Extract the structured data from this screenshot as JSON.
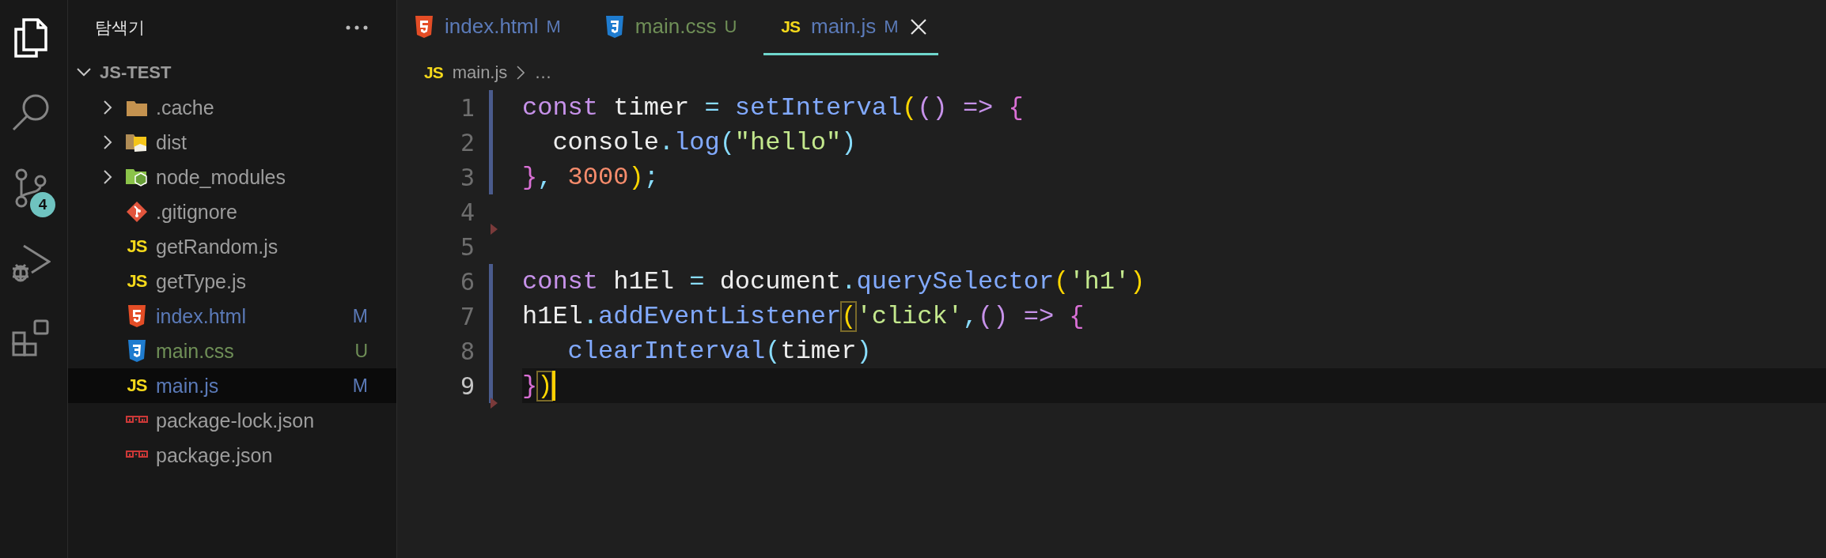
{
  "activity_bar": {
    "items": [
      {
        "kind": "explorer",
        "selected": true
      },
      {
        "kind": "search",
        "selected": false
      },
      {
        "kind": "source-control",
        "selected": false,
        "badge": "4"
      },
      {
        "kind": "run",
        "selected": false
      },
      {
        "kind": "extensions",
        "selected": false
      }
    ]
  },
  "sidebar": {
    "title": "탐색기",
    "root": {
      "label": "JS-TEST",
      "expanded": true,
      "children": [
        {
          "label": ".cache",
          "kind": "folder",
          "expanded": false,
          "selected": false
        },
        {
          "label": "dist",
          "kind": "folder-dist",
          "expanded": false,
          "selected": false
        },
        {
          "label": "node_modules",
          "kind": "folder-node",
          "expanded": false,
          "selected": false
        },
        {
          "label": ".gitignore",
          "kind": "git",
          "selected": false
        },
        {
          "label": "getRandom.js",
          "kind": "js",
          "icon_label": "JS",
          "selected": false
        },
        {
          "label": "getType.js",
          "kind": "js",
          "icon_label": "JS",
          "selected": false
        },
        {
          "label": "index.html",
          "kind": "html",
          "status": "M",
          "color": "#5b7ab8",
          "selected": false
        },
        {
          "label": "main.css",
          "kind": "css",
          "status": "U",
          "color": "#6f8f57",
          "selected": false
        },
        {
          "label": "main.js",
          "kind": "js",
          "icon_label": "JS",
          "status": "M",
          "color": "#5b7ab8",
          "selected": true
        },
        {
          "label": "package-lock.json",
          "kind": "npm",
          "selected": false
        },
        {
          "label": "package.json",
          "kind": "npm",
          "selected": false
        }
      ]
    }
  },
  "tabs": [
    {
      "label": "index.html",
      "kind": "html",
      "status": "M",
      "color": "#5b7ab8",
      "selected": false
    },
    {
      "label": "main.css",
      "kind": "css",
      "status": "U",
      "color": "#6f8f57",
      "selected": false
    },
    {
      "label": "main.js",
      "kind": "js",
      "icon_label": "JS",
      "status": "M",
      "color": "#5b7ab8",
      "selected": true
    }
  ],
  "breadcrumb": {
    "icon_label": "JS",
    "items": [
      "main.js",
      "…"
    ]
  },
  "code": {
    "lines": [
      {
        "number": "1",
        "modified": true,
        "current": false,
        "deleted_after": false,
        "tokens": [
          {
            "text": "const",
            "kind": "keyword"
          },
          {
            "text": " timer ",
            "kind": "ident"
          },
          {
            "text": "=",
            "kind": "op"
          },
          {
            "text": " setInterval",
            "kind": "func"
          },
          {
            "text": "(",
            "kind": "bracket1"
          },
          {
            "text": "()",
            "kind": "bracket2"
          },
          {
            "text": " =>",
            "kind": "keyword"
          },
          {
            "text": " {",
            "kind": "brace"
          }
        ]
      },
      {
        "number": "2",
        "modified": true,
        "current": false,
        "deleted_after": false,
        "tokens": [
          {
            "text": "  console",
            "kind": "ident"
          },
          {
            "text": ".",
            "kind": "punct"
          },
          {
            "text": "log",
            "kind": "func"
          },
          {
            "text": "(",
            "kind": "bracket3"
          },
          {
            "text": "\"hello\"",
            "kind": "string"
          },
          {
            "text": ")",
            "kind": "bracket3"
          }
        ]
      },
      {
        "number": "3",
        "modified": true,
        "current": false,
        "deleted_after": false,
        "tokens": [
          {
            "text": "}",
            "kind": "brace"
          },
          {
            "text": ", ",
            "kind": "punct"
          },
          {
            "text": "3000",
            "kind": "number"
          },
          {
            "text": ")",
            "kind": "bracket1"
          },
          {
            "text": ";",
            "kind": "punct"
          }
        ]
      },
      {
        "number": "4",
        "modified": false,
        "current": false,
        "deleted_after": true
      },
      {
        "number": "5",
        "modified": false,
        "current": false,
        "deleted_after": false
      },
      {
        "number": "6",
        "modified": true,
        "current": false,
        "deleted_after": false,
        "tokens": [
          {
            "text": "const",
            "kind": "keyword"
          },
          {
            "text": " h1El ",
            "kind": "ident"
          },
          {
            "text": "=",
            "kind": "op"
          },
          {
            "text": " document",
            "kind": "ident"
          },
          {
            "text": ".",
            "kind": "punct"
          },
          {
            "text": "querySelector",
            "kind": "func"
          },
          {
            "text": "(",
            "kind": "bracket1"
          },
          {
            "text": "'h1'",
            "kind": "string"
          },
          {
            "text": ")",
            "kind": "bracket1"
          }
        ]
      },
      {
        "number": "7",
        "modified": true,
        "current": false,
        "deleted_after": false,
        "tokens": [
          {
            "text": "h1El",
            "kind": "ident"
          },
          {
            "text": ".",
            "kind": "punct"
          },
          {
            "text": "addEventListener",
            "kind": "func"
          },
          {
            "text": "(",
            "kind": "bracket1",
            "matched": true
          },
          {
            "text": "'click'",
            "kind": "string"
          },
          {
            "text": ",",
            "kind": "punct"
          },
          {
            "text": "()",
            "kind": "bracket2"
          },
          {
            "text": " =>",
            "kind": "keyword"
          },
          {
            "text": " {",
            "kind": "brace"
          }
        ]
      },
      {
        "number": "8",
        "modified": true,
        "current": false,
        "deleted_after": false,
        "tokens": [
          {
            "text": "   clearInterval",
            "kind": "func"
          },
          {
            "text": "(",
            "kind": "bracket3"
          },
          {
            "text": "timer",
            "kind": "ident"
          },
          {
            "text": ")",
            "kind": "bracket3"
          }
        ]
      },
      {
        "number": "9",
        "modified": true,
        "current": true,
        "cursor": true,
        "deleted_after": true,
        "tokens": [
          {
            "text": "}",
            "kind": "brace"
          },
          {
            "text": ")",
            "kind": "bracket1",
            "matched": true
          }
        ]
      }
    ]
  }
}
